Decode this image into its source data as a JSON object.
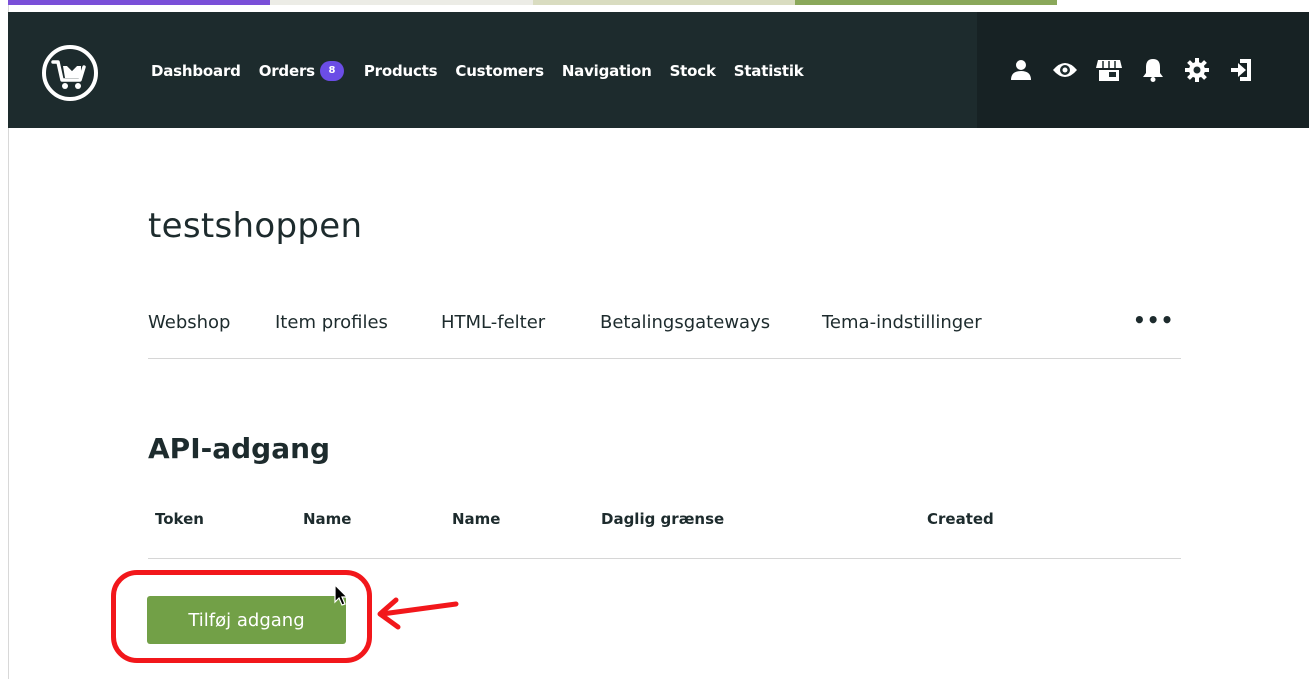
{
  "colors": {
    "header_bg": "#1d2b2d",
    "accent_purple": "#6b4de6",
    "button_green": "#72a047",
    "annotation_red": "#f2171b",
    "stripe": [
      "#7a4fd8",
      "#ecece6",
      "#d9dcc0",
      "#8aa85a",
      "#ffffff"
    ]
  },
  "header": {
    "logo_icon": "cart-download-icon",
    "nav": [
      {
        "label": "Dashboard"
      },
      {
        "label": "Orders",
        "badge": "8"
      },
      {
        "label": "Products"
      },
      {
        "label": "Customers"
      },
      {
        "label": "Navigation"
      },
      {
        "label": "Stock"
      },
      {
        "label": "Statistik"
      }
    ],
    "icons": [
      "user-icon",
      "eye-icon",
      "storefront-icon",
      "bell-icon",
      "gear-icon",
      "logout-icon"
    ]
  },
  "page": {
    "shop_title": "testshoppen",
    "tabs": [
      "Webshop",
      "Item profiles",
      "HTML-felter",
      "Betalingsgateways",
      "Tema-indstillinger"
    ],
    "more_label": "•••",
    "section_title": "API-adgang",
    "table_headers": [
      "Token",
      "Name",
      "Name",
      "Daglig grænse",
      "Created"
    ],
    "add_button_label": "Tilføj adgang"
  }
}
